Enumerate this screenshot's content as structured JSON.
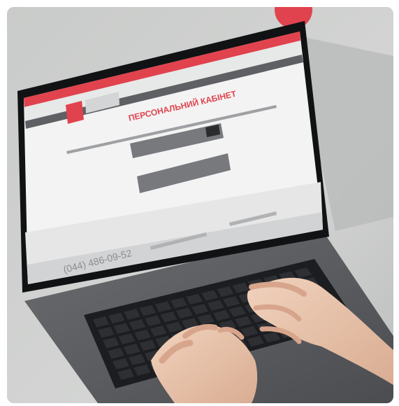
{
  "screen": {
    "logo_text": "",
    "heading": "ПЕРСОНАЛЬНИЙ КАБІНЕТ",
    "notice": "",
    "button_1": "",
    "button_2": "",
    "phone": "(044) 486-09-52",
    "footer_small_1": "",
    "footer_small_2": ""
  },
  "colors": {
    "accent": "#e0434d",
    "screen_bg": "#f3f3f3",
    "header_gray": "#5e6064",
    "button_gray": "#77797d",
    "laptop_body": "#5b5d61",
    "bezel": "#111214"
  },
  "objects": [
    "laptop",
    "keyboard",
    "hands",
    "red-circle-badge"
  ]
}
